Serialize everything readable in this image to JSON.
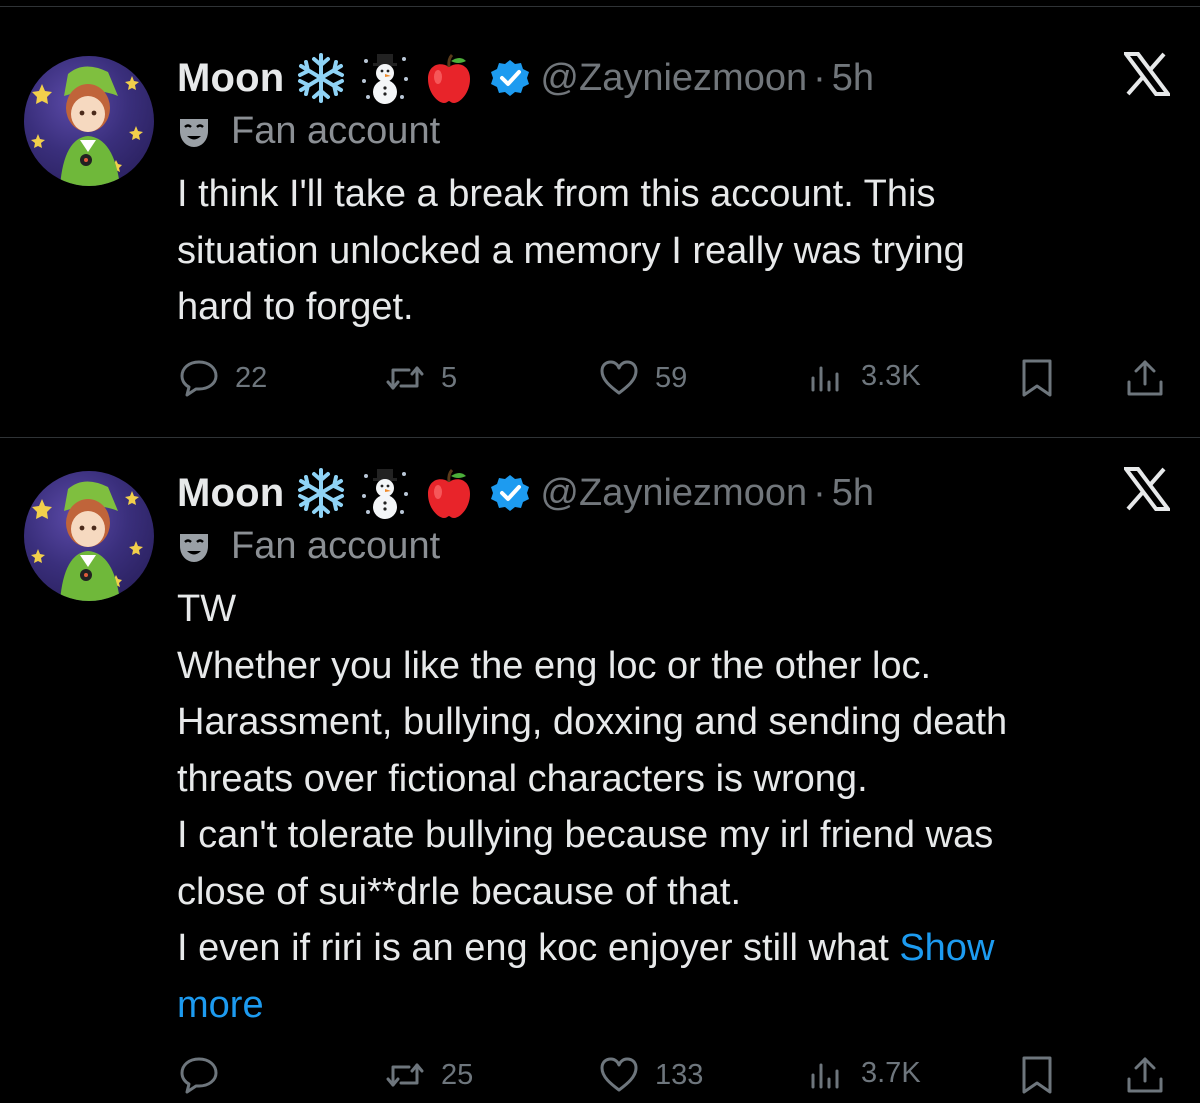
{
  "colors": {
    "background": "#000000",
    "text_primary": "#e7e9ea",
    "text_secondary": "#71767b",
    "link": "#1d9bf0",
    "verified": "#1d9bf0"
  },
  "tweets": [
    {
      "author_name": "Moon",
      "emojis": [
        "snowflake-emoji",
        "snowman-emoji",
        "red-apple-emoji"
      ],
      "handle": "@Zayniezmoon",
      "separator": "·",
      "time": "5h",
      "account_label_icon": "theater-mask-icon",
      "account_label": "Fan account",
      "lines": [
        "I think I'll take a break from this account. This",
        "situation unlocked a memory I really was trying",
        "hard to forget."
      ],
      "show_more": "",
      "replies": "22",
      "reposts": "5",
      "likes": "59",
      "views": "3.3K"
    },
    {
      "author_name": "Moon",
      "emojis": [
        "snowflake-emoji",
        "snowman-emoji",
        "red-apple-emoji"
      ],
      "handle": "@Zayniezmoon",
      "separator": "·",
      "time": "5h",
      "account_label_icon": "theater-mask-icon",
      "account_label": "Fan account",
      "lines": [
        "TW",
        "Whether you like the eng loc or the other loc.",
        "Harassment, bullying, doxxing and sending death",
        "threats over fictional characters is wrong.",
        "I can't tolerate bullying because my irl friend was",
        "close of sui**drle because of that.",
        "I even if riri is an eng koc enjoyer still what "
      ],
      "show_more_part1": "Show",
      "show_more_part2": "more",
      "replies": "",
      "reposts": "25",
      "likes": "133",
      "views": "3.7K"
    }
  ]
}
